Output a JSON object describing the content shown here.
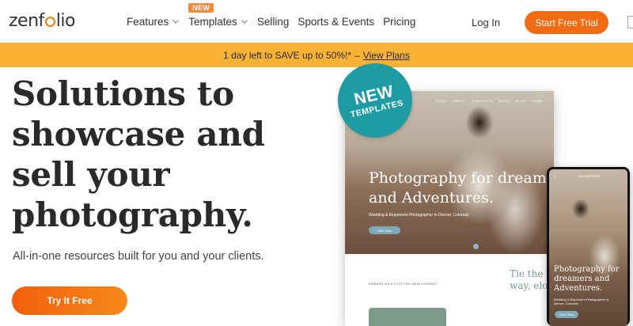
{
  "header": {
    "logo_text": "zenfolio",
    "nav": [
      {
        "label": "Features",
        "has_dropdown": true
      },
      {
        "label": "Templates",
        "has_dropdown": true,
        "badge": "NEW"
      },
      {
        "label": "Selling",
        "has_dropdown": false
      },
      {
        "label": "Sports & Events",
        "has_dropdown": false
      },
      {
        "label": "Pricing",
        "has_dropdown": false
      }
    ],
    "login_label": "Log In",
    "cta_label": "Start Free Trial"
  },
  "promo": {
    "message": "1 day left to SAVE up to 50%!*",
    "separator": "–",
    "link_label": "View Plans"
  },
  "hero": {
    "title_lines": [
      "Solutions to",
      "showcase and",
      "sell your",
      "photography."
    ],
    "subtitle": "All-in-one resources built for you and your clients.",
    "cta_label": "Try It Free"
  },
  "badge_circle": {
    "big": "NEW",
    "small": "TEMPLATES"
  },
  "mockup": {
    "nav_items": [
      "HOME",
      "ABOUT",
      "PORTFOLIO",
      "BOOK",
      "BLOG",
      "MORE"
    ],
    "headline_line1": "Photography for dreamers",
    "headline_line2": "and Adventures.",
    "tagline": "Wedding & Elopement Photographer in Denver, Colorado",
    "button": "View Story",
    "embark_text": "EMBARK ON A EXCITING NEW JOURNEY",
    "quote_line1": "Tie the knot",
    "quote_line2": "way, elope"
  },
  "phone": {
    "brand": "WANDERTHEE",
    "headline_line1": "Photography for",
    "headline_line2": "dreamers and",
    "headline_line3": "Adventures.",
    "tagline": "Wedding & Elopement Photographer in Denver, Colorado",
    "button": "View Story"
  },
  "colors": {
    "accent_orange": "#f26b12",
    "promo_yellow": "#f9b233",
    "badge_teal": "#1f9ba3"
  }
}
